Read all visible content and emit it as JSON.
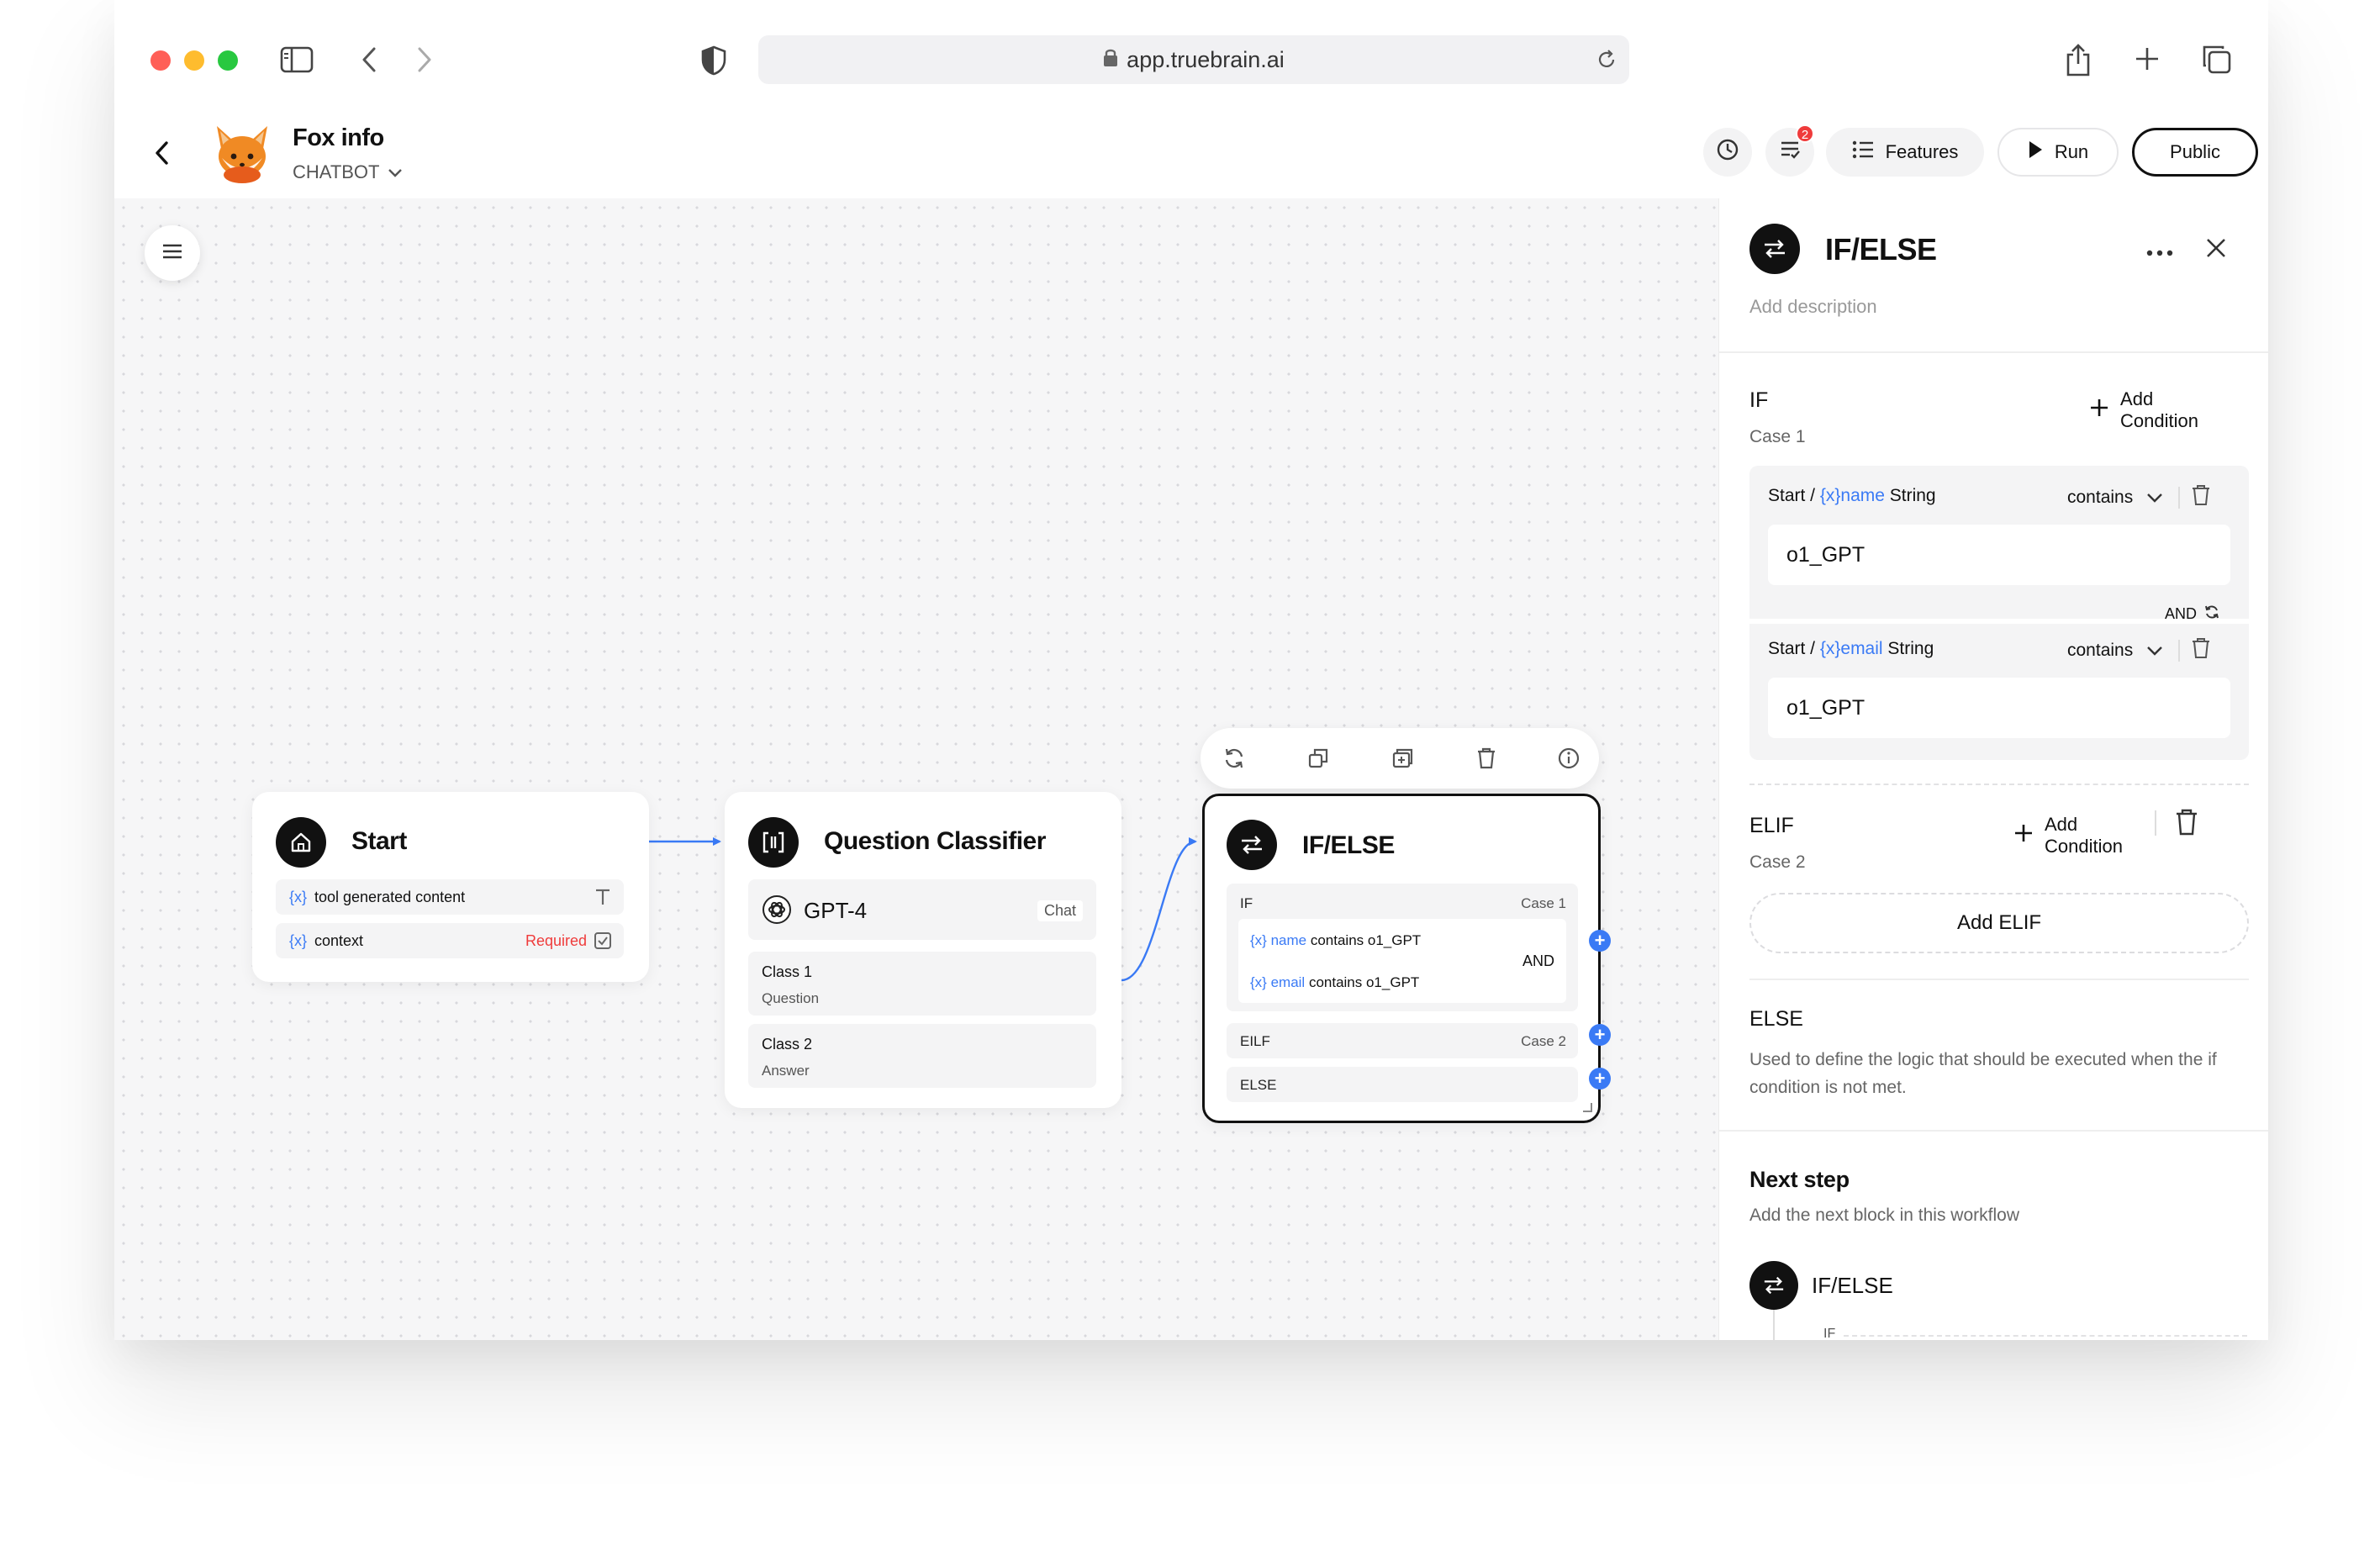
{
  "browser": {
    "url": "app.truebrain.ai",
    "colors": {
      "red": "#ff5f57",
      "yellow": "#febc2e",
      "green": "#28c840"
    }
  },
  "header": {
    "title": "Fox info",
    "type_label": "CHATBOT",
    "notification_count": "2",
    "features_label": "Features",
    "run_label": "Run",
    "public_label": "Public"
  },
  "nodes": {
    "start": {
      "title": "Start",
      "var_prefix": "{x}",
      "fields": [
        {
          "name": "tool generated content",
          "tag": ""
        },
        {
          "name": "context",
          "tag": "Required"
        }
      ]
    },
    "classifier": {
      "title": "Question Classifier",
      "model": "GPT-4",
      "model_mode": "Chat",
      "classes": [
        {
          "name": "Class 1",
          "desc": "Question"
        },
        {
          "name": "Class 2",
          "desc": "Answer"
        }
      ]
    },
    "ifelse": {
      "title": "IF/ELSE",
      "if_label": "IF",
      "case1": "Case 1",
      "cond1_var": "{x} name",
      "cond1_text": "contains o1_GPT",
      "cond2_var": "{x} email",
      "cond2_text": "contains o1_GPT",
      "and_label": "AND",
      "elif_label": "EILF",
      "case2": "Case 2",
      "else_label": "ELSE"
    }
  },
  "panel": {
    "title": "IF/ELSE",
    "description_placeholder": "Add description",
    "if_section": {
      "label": "IF",
      "case": "Case 1",
      "add_condition": "Add Condition",
      "conditions": [
        {
          "source": "Start / ",
          "var": "{x}name",
          "type": " String",
          "operator": "contains",
          "value": "o1_GPT"
        },
        {
          "source": "Start / ",
          "var": "{x}email",
          "type": " String",
          "operator": "contains",
          "value": "o1_GPT"
        }
      ],
      "logic": "AND"
    },
    "elif_section": {
      "label": "ELIF",
      "case": "Case 2",
      "add_condition": "Add Condition",
      "add_elif": "Add ELIF"
    },
    "else_section": {
      "label": "ELSE",
      "description": "Used to define the logic that should be executed when the if condition is not met."
    },
    "next_step": {
      "title": "Next step",
      "description": "Add the next block in this workflow",
      "block_title": "IF/ELSE",
      "block_sub": "IF"
    }
  }
}
